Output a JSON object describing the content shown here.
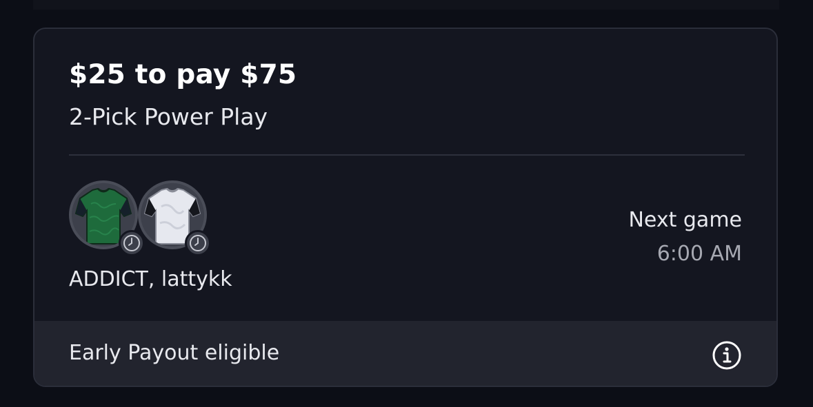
{
  "entry": {
    "title": "$25 to pay $75",
    "subtitle": "2-Pick Power Play",
    "players_text": "ADDICT, lattykk",
    "avatars": [
      {
        "icon": "green-jersey-icon",
        "color": "#1e6b3c"
      },
      {
        "icon": "white-jersey-icon",
        "color": "#e6e8ef"
      }
    ],
    "next_game": {
      "label": "Next game",
      "time": "6:00 AM"
    },
    "footer": {
      "text": "Early Payout eligible",
      "icon": "info-icon"
    }
  },
  "colors": {
    "background": "#0c0e16",
    "card": "#141620",
    "footer": "#22242e",
    "text_primary": "#ffffff",
    "text_secondary": "#a6a8b1"
  }
}
